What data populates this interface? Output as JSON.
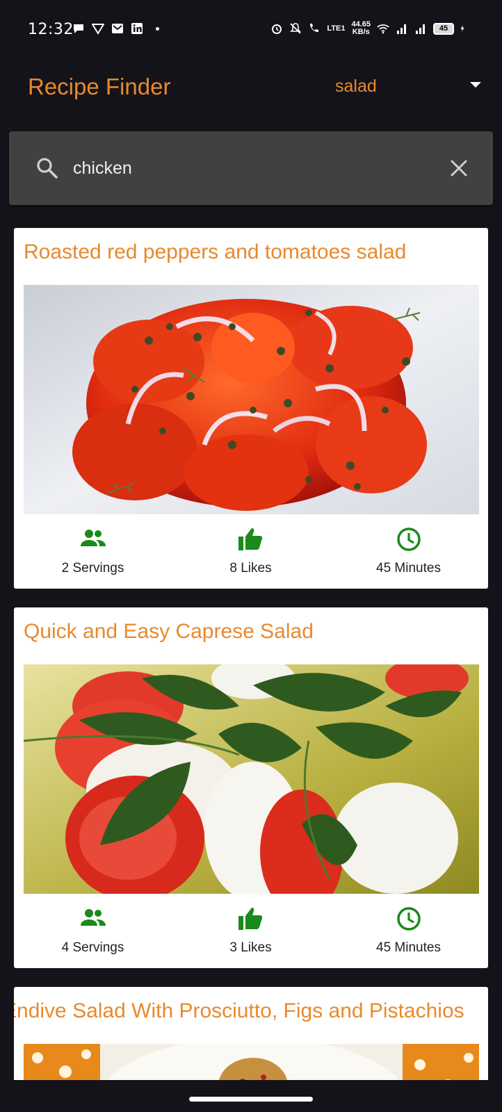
{
  "status_bar": {
    "time": "12:32",
    "net_speed_top": "44.65",
    "net_speed_bottom": "KB/s",
    "lte_label": "LTE1",
    "battery": "45"
  },
  "app": {
    "title": "Recipe Finder",
    "category": "salad"
  },
  "search": {
    "value": "chicken",
    "placeholder": ""
  },
  "recipes": [
    {
      "title": "Roasted red peppers and tomatoes salad",
      "servings": "2 Servings",
      "likes": "8 Likes",
      "time": "45 Minutes"
    },
    {
      "title": "Quick and Easy Caprese Salad",
      "servings": "4 Servings",
      "likes": "3 Likes",
      "time": "45 Minutes"
    },
    {
      "title": "Endive Salad With Prosciutto, Figs and Pistachios"
    }
  ],
  "colors": {
    "accent": "#e8892c",
    "icon_green": "#1a8a1a",
    "background": "#14131a",
    "search_bg": "#414141"
  },
  "icons": {
    "servings": "people-icon",
    "likes": "thumbs-up-icon",
    "time": "clock-icon"
  }
}
